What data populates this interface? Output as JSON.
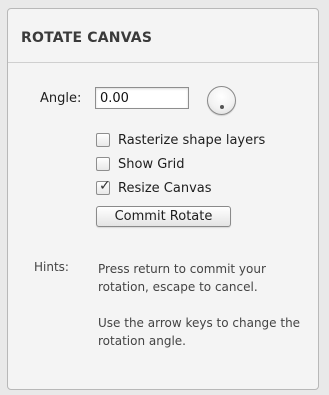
{
  "panel": {
    "title": "ROTATE CANVAS"
  },
  "angle": {
    "label": "Angle:",
    "value": "0.00"
  },
  "options": [
    {
      "label": "Rasterize shape layers",
      "checked": false
    },
    {
      "label": "Show Grid",
      "checked": false
    },
    {
      "label": "Resize Canvas",
      "checked": true
    }
  ],
  "commit_button": {
    "label": "Commit Rotate"
  },
  "hints": {
    "label": "Hints:",
    "line1": "Press return to commit your rotation, escape to cancel.",
    "line2": "Use the arrow keys to change the rotation angle."
  },
  "icons": {
    "angle_dial": "rotation-dial-icon",
    "checkmark": "checkmark-icon"
  }
}
